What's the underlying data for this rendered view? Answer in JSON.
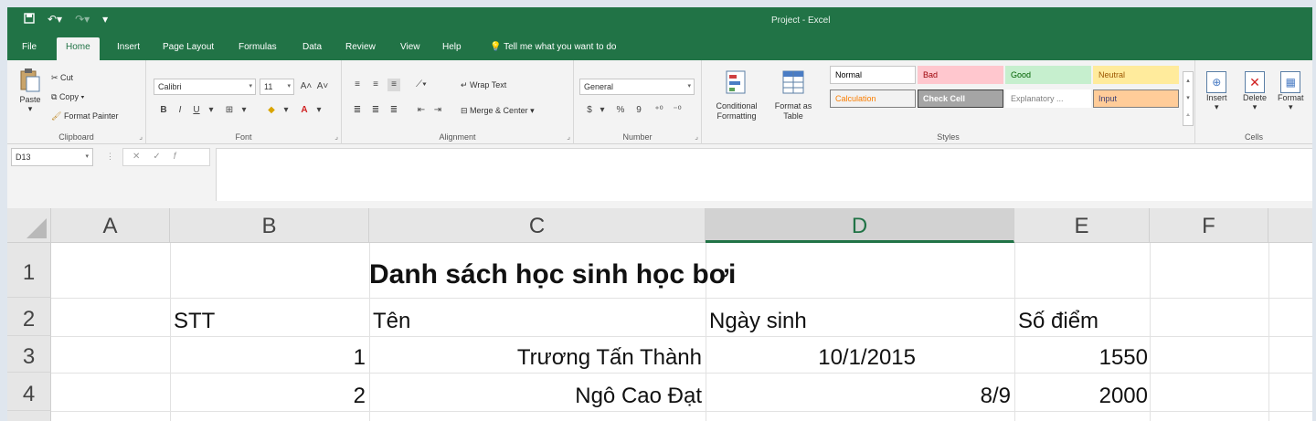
{
  "window": {
    "title": "Project - Excel",
    "qat": {
      "save_icon": "save-icon",
      "undo_icon": "undo-icon",
      "redo_icon": "redo-icon",
      "customize_icon": "chevron-down-icon"
    }
  },
  "tabs": [
    "File",
    "Home",
    "Insert",
    "Page Layout",
    "Formulas",
    "Data",
    "Review",
    "View",
    "Help"
  ],
  "active_tab": "Home",
  "tell_me": "Tell me what you want to do",
  "ribbon": {
    "clipboard": {
      "paste": "Paste",
      "cut": "Cut",
      "copy": "Copy",
      "format_painter": "Format Painter",
      "label": "Clipboard"
    },
    "font": {
      "name": "Calibri",
      "size": "11",
      "bold": "B",
      "italic": "I",
      "underline": "U",
      "label": "Font"
    },
    "alignment": {
      "wrap_text": "Wrap Text",
      "merge_center": "Merge & Center",
      "label": "Alignment"
    },
    "number": {
      "format": "General",
      "currency": "$",
      "percent": "%",
      "comma": "9",
      "label": "Number"
    },
    "styles": {
      "conditional_formatting": "Conditional Formatting",
      "format_as_table": "Format as Table",
      "cells": [
        {
          "text": "Normal",
          "bg": "#ffffff",
          "fg": "#000000",
          "border": "#c6c6c6"
        },
        {
          "text": "Bad",
          "bg": "#ffc7ce",
          "fg": "#9c0006",
          "border": "#ffc7ce"
        },
        {
          "text": "Good",
          "bg": "#c6efce",
          "fg": "#006100",
          "border": "#c6efce"
        },
        {
          "text": "Neutral",
          "bg": "#ffeb9c",
          "fg": "#9c5700",
          "border": "#ffeb9c"
        },
        {
          "text": "Calculation",
          "bg": "#f2f2f2",
          "fg": "#fa7d00",
          "border": "#7f7f7f"
        },
        {
          "text": "Check Cell",
          "bg": "#a5a5a5",
          "fg": "#ffffff",
          "border": "#3f3f3f"
        },
        {
          "text": "Explanatory ...",
          "bg": "#ffffff",
          "fg": "#7f7f7f",
          "border": "#ffffff"
        },
        {
          "text": "Input",
          "bg": "#ffcc99",
          "fg": "#3f3f76",
          "border": "#7f7f7f"
        }
      ],
      "label": "Styles"
    },
    "cells": {
      "insert": "Insert",
      "delete": "Delete",
      "format": "Format",
      "label": "Cells"
    }
  },
  "formula_bar": {
    "name_box": "D13",
    "value": ""
  },
  "grid": {
    "columns": [
      "A",
      "B",
      "C",
      "D",
      "E",
      "F"
    ],
    "selected_column": "D",
    "rows": [
      "1",
      "2",
      "3",
      "4"
    ],
    "title": "Danh sách học sinh học bơi",
    "headers": {
      "stt": "STT",
      "ten": "Tên",
      "ngay_sinh": "Ngày sinh",
      "so_diem": "Số điểm"
    },
    "records": [
      {
        "stt": "1",
        "ten": "Trương Tấn Thành",
        "ngay_sinh": "10/1/2015",
        "so_diem": "1550"
      },
      {
        "stt": "2",
        "ten": "Ngô Cao Đạt",
        "ngay_sinh": "8/9",
        "so_diem": "2000"
      }
    ]
  },
  "colors": {
    "brand": "#217346"
  }
}
